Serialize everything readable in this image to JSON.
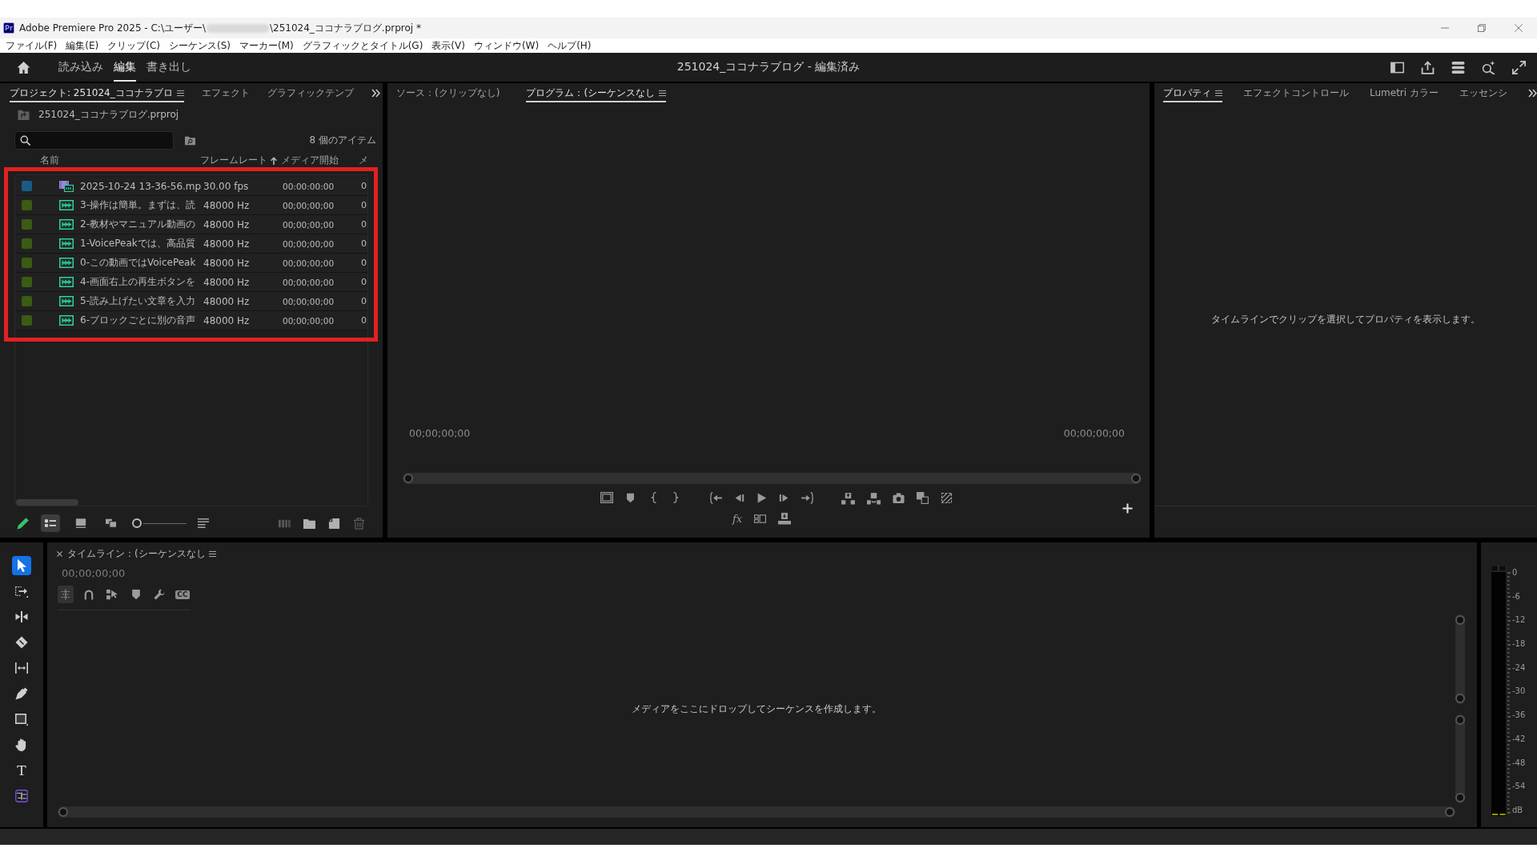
{
  "window": {
    "app_badge": "Pr",
    "title_start": "Adobe Premiere Pro 2025 - C:\\ユーザー\\",
    "title_end": "\\251024_ココナラブログ.prproj *"
  },
  "menu": [
    "ファイル(F)",
    "編集(E)",
    "クリップ(C)",
    "シーケンス(S)",
    "マーカー(M)",
    "グラフィックとタイトル(G)",
    "表示(V)",
    "ウィンドウ(W)",
    "ヘルプ(H)"
  ],
  "header": {
    "tabs": [
      {
        "label": "読み込み",
        "selected": false
      },
      {
        "label": "編集",
        "selected": true
      },
      {
        "label": "書き出し",
        "selected": false
      }
    ],
    "title": "251024_ココナラブログ - 編集済み"
  },
  "project_panel": {
    "tabs": [
      {
        "label": "プロジェクト: 251024_ココナラブロ",
        "selected": true
      },
      {
        "label": "エフェクト",
        "selected": false
      },
      {
        "label": "グラフィックテンプ",
        "selected": false
      }
    ],
    "path": "251024_ココナラブログ.prproj",
    "item_count": "8 個のアイテム",
    "columns": [
      {
        "label": "名前",
        "sorted": false
      },
      {
        "label": "フレームレート",
        "sorted": true
      },
      {
        "label": "メディア開始",
        "sorted": false
      },
      {
        "label": "メ",
        "sorted": false
      }
    ],
    "highlighted": true,
    "rows": [
      {
        "kind": "video",
        "color": "#1b5b85",
        "name": "2025-10-24 13-36-56.mp",
        "frame_rate": "30.00 fps",
        "media_start": "00:00:00:00",
        "column_4": "0"
      },
      {
        "kind": "audio",
        "color": "#3a5c12",
        "name": "3-操作は簡単。まずは、読",
        "frame_rate": "48000 Hz",
        "media_start": "00;00;00;00",
        "column_4": "0"
      },
      {
        "kind": "audio",
        "color": "#3a5c12",
        "name": "2-教材やマニュアル動画の",
        "frame_rate": "48000 Hz",
        "media_start": "00;00;00;00",
        "column_4": "0"
      },
      {
        "kind": "audio",
        "color": "#3a5c12",
        "name": "1-VoicePeakでは、高品質",
        "frame_rate": "48000 Hz",
        "media_start": "00;00;00;00",
        "column_4": "0"
      },
      {
        "kind": "audio",
        "color": "#3a5c12",
        "name": "0-この動画ではVoicePeak",
        "frame_rate": "48000 Hz",
        "media_start": "00;00;00;00",
        "column_4": "0"
      },
      {
        "kind": "audio",
        "color": "#3a5c12",
        "name": "4-画面右上の再生ボタンを",
        "frame_rate": "48000 Hz",
        "media_start": "00;00;00;00",
        "column_4": "0"
      },
      {
        "kind": "audio",
        "color": "#3a5c12",
        "name": "5-読み上げたい文章を入力",
        "frame_rate": "48000 Hz",
        "media_start": "00;00;00;00",
        "column_4": "0"
      },
      {
        "kind": "audio",
        "color": "#3a5c12",
        "name": "6-ブロックごとに別の音声",
        "frame_rate": "48000 Hz",
        "media_start": "00;00;00;00",
        "column_4": "0"
      }
    ],
    "view_buttons": [
      {
        "kind": "list",
        "selected": true
      },
      {
        "kind": "icon",
        "selected": false
      },
      {
        "kind": "freeform",
        "selected": false
      }
    ],
    "zoom_slider": {
      "level": 0
    },
    "actions": [
      {
        "kind": "automate",
        "disabled": true
      },
      {
        "kind": "new-bin",
        "disabled": false
      },
      {
        "kind": "new-item",
        "disabled": false
      },
      {
        "kind": "trash",
        "disabled": true
      }
    ]
  },
  "program_monitor": {
    "tabs": [
      {
        "label": "ソース：(クリップなし)",
        "selected": false
      },
      {
        "label": "プログラム：(シーケンスなし",
        "selected": true
      }
    ],
    "timecode_in": "00;00;00;00",
    "timecode_out": "00;00;00;00",
    "effects_label": "fx"
  },
  "properties_panel": {
    "tabs": [
      {
        "label": "プロパティ",
        "selected": true
      },
      {
        "label": "エフェクトコントロール",
        "selected": false
      },
      {
        "label": "Lumetri カラー",
        "selected": false
      },
      {
        "label": "エッセンシ",
        "selected": false
      }
    ],
    "message": "タイムラインでクリップを選択してプロパティを表示します。"
  },
  "tools": [
    {
      "kind": "selection",
      "selected": true
    },
    {
      "kind": "track-select",
      "selected": false
    },
    {
      "kind": "ripple",
      "selected": false
    },
    {
      "kind": "razor",
      "selected": false
    },
    {
      "kind": "slip",
      "selected": false
    },
    {
      "kind": "pen",
      "selected": false
    },
    {
      "kind": "rectangle",
      "selected": false
    },
    {
      "kind": "hand",
      "selected": false
    },
    {
      "kind": "type",
      "label": "T",
      "selected": false
    },
    {
      "kind": "arrows",
      "selected": false
    }
  ],
  "timeline_panel": {
    "tab": "タイムライン：(シーケンスなし",
    "timecode": "00;00;00;00",
    "toolbar": [
      {
        "kind": "nest",
        "on": true
      },
      {
        "kind": "snap",
        "on": false
      },
      {
        "kind": "linked",
        "on": false
      },
      {
        "kind": "marker",
        "on": false
      },
      {
        "kind": "settings",
        "on": false
      },
      {
        "kind": "captions",
        "label": "CC",
        "on": false
      }
    ],
    "message": "メディアをここにドロップしてシーケンスを作成します。"
  },
  "audio_meter": {
    "scale": [
      "0",
      "-6",
      "-12",
      "-18",
      "-24",
      "-30",
      "-36",
      "-42",
      "-48",
      "-54",
      "dB"
    ]
  }
}
